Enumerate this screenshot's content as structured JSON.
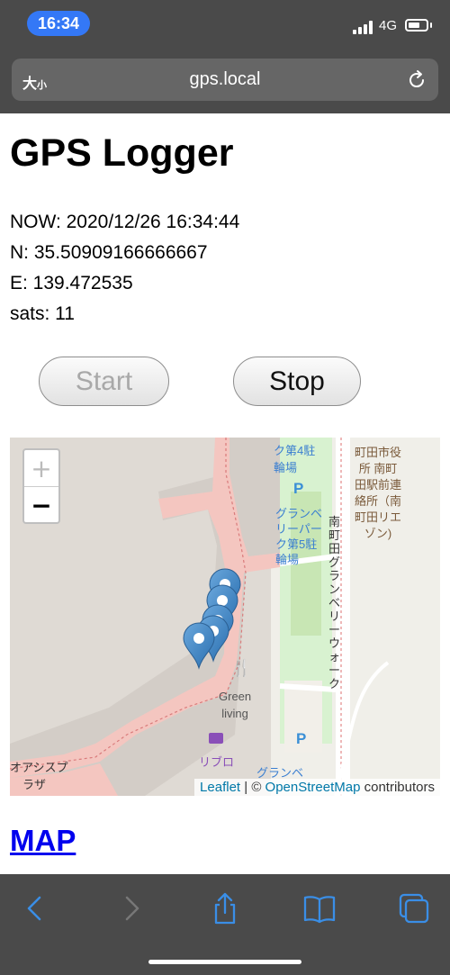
{
  "status_bar": {
    "time": "16:34",
    "network": "4G"
  },
  "url_bar": {
    "font_size_label": "大",
    "font_size_small": "小",
    "url": "gps.local"
  },
  "page": {
    "title": "GPS Logger",
    "now": "NOW: 2020/12/26 16:34:44",
    "lat": "N: 35.50909166666667",
    "lon": "E: 139.472535",
    "sats": "sats: 11",
    "start_label": "Start",
    "stop_label": "Stop",
    "map_link": "MAP"
  },
  "map": {
    "zoom_in": "+",
    "zoom_out": "−",
    "attribution": {
      "leaflet": "Leaflet",
      "sep": " | © ",
      "osm": "OpenStreetMap",
      "suffix": " contributors"
    },
    "labels": {
      "bike4_line1": "ク第4駐",
      "bike4_line2": "輪場",
      "granbe_1": "グランベ",
      "granbe_2": "リーパー",
      "granbe_3": "ク第5駐",
      "granbe_4": "輪場",
      "cityhall_1": "町田市役",
      "cityhall_2": "所 南町",
      "cityhall_3": "田駅前連",
      "cityhall_4": "絡所（南",
      "cityhall_5": "町田リエ",
      "cityhall_6": "ゾン)",
      "street": "南町田グランベリーウォーク",
      "green_1": "Green",
      "green_2": "living",
      "libro": "リブロ",
      "granbe_bottom": "グランベ",
      "plaza_1": "オアシスプ",
      "plaza_2": "ラザ"
    },
    "markers_count": 5
  },
  "toolbar": [
    "back-icon",
    "forward-icon",
    "share-icon",
    "bookmarks-icon",
    "tabs-icon"
  ]
}
